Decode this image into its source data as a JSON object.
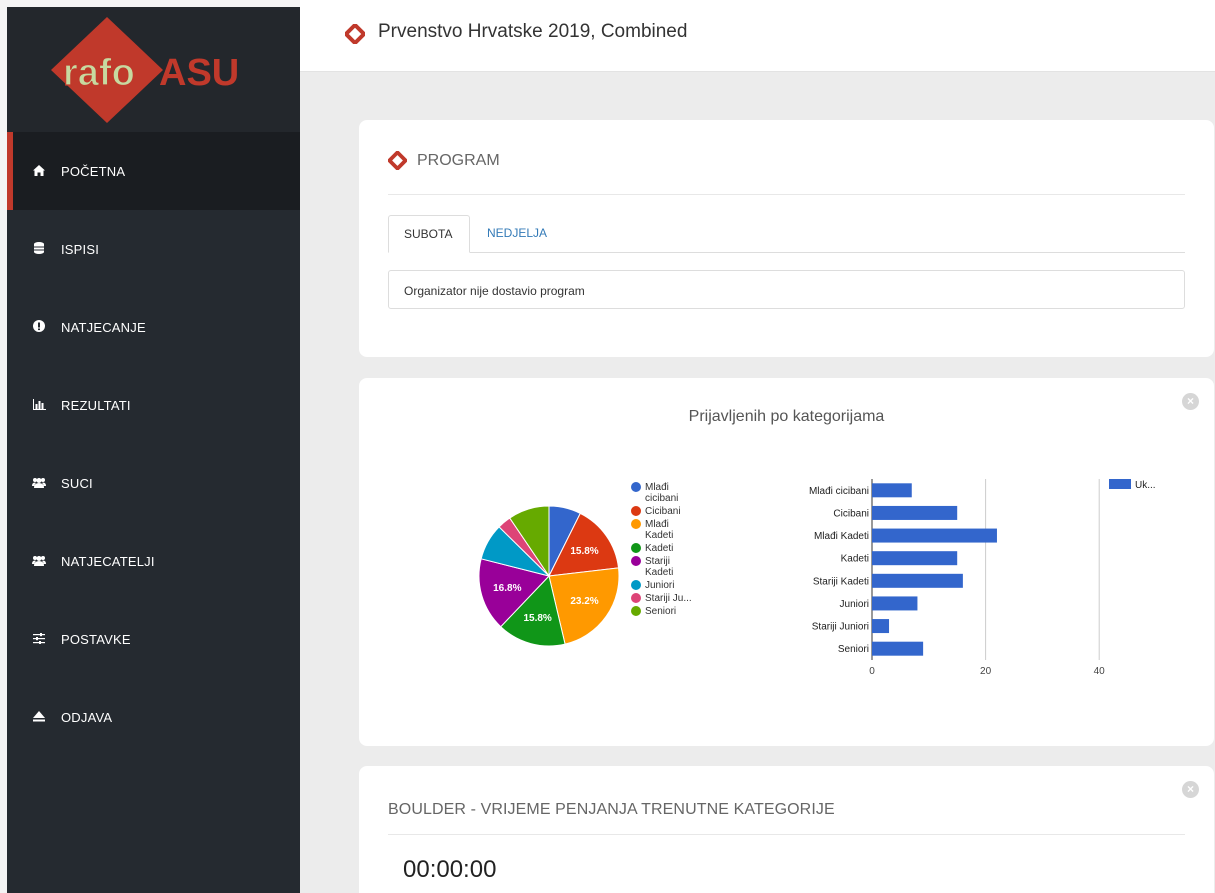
{
  "logo": {
    "text_part1": "rafo",
    "text_part2": "ASU"
  },
  "sidebar": {
    "items": [
      {
        "label": "POČETNA",
        "icon": "home-icon",
        "active": true
      },
      {
        "label": "ISPISI",
        "icon": "database-icon",
        "active": false
      },
      {
        "label": "NATJECANJE",
        "icon": "exclamation-icon",
        "active": false
      },
      {
        "label": "REZULTATI",
        "icon": "bar-chart-icon",
        "active": false
      },
      {
        "label": "SUCI",
        "icon": "users-icon",
        "active": false
      },
      {
        "label": "NATJECATELJI",
        "icon": "users-icon",
        "active": false
      },
      {
        "label": "POSTAVKE",
        "icon": "sliders-icon",
        "active": false
      },
      {
        "label": "ODJAVA",
        "icon": "eject-icon",
        "active": false
      }
    ]
  },
  "header": {
    "title": "Prvenstvo Hrvatske 2019, Combined"
  },
  "program": {
    "heading": "PROGRAM",
    "tabs": [
      {
        "label": "SUBOTA"
      },
      {
        "label": "NEDJELJA"
      }
    ],
    "note": "Organizator nije dostavio program"
  },
  "chart_panel": {
    "title": "Prijavljenih po kategorijama"
  },
  "chart_data": [
    {
      "type": "pie",
      "categories": [
        "Mlađi cicibani",
        "Cicibani",
        "Mlađi Kadeti",
        "Kadeti",
        "Stariji Kadeti",
        "Juniori",
        "Stariji Juniori",
        "Seniori"
      ],
      "legend_labels": [
        "Mlađi cicibani",
        "Cicibani",
        "Mlađi Kadeti",
        "Kadeti",
        "Stariji Kadeti",
        "Juniori",
        "Stariji Ju...",
        "Seniori"
      ],
      "values": [
        7,
        15,
        22,
        15,
        16,
        8,
        3,
        9
      ],
      "slice_labels": [
        "",
        "15.8%",
        "23.2%",
        "15.8%",
        "16.8%",
        "",
        "",
        ""
      ],
      "colors": [
        "#3366cc",
        "#dc3912",
        "#ff9900",
        "#109618",
        "#990099",
        "#0099c6",
        "#dd4477",
        "#66aa00"
      ],
      "legend_position": "right"
    },
    {
      "type": "bar",
      "orientation": "horizontal",
      "categories": [
        "Mlađi cicibani",
        "Cicibani",
        "Mlađi Kadeti",
        "Kadeti",
        "Stariji Kadeti",
        "Juniori",
        "Stariji Juniori",
        "Seniori"
      ],
      "series": [
        {
          "name": "Uk...",
          "values": [
            7,
            15,
            22,
            15,
            16,
            8,
            3,
            9
          ],
          "color": "#3366cc"
        }
      ],
      "xlim": [
        0,
        50
      ],
      "xticks": [
        0,
        20,
        40
      ],
      "grid": true,
      "legend_position": "top-right"
    }
  ],
  "boulder": {
    "heading": "BOULDER - VRIJEME PENJANJA TRENUTNE KATEGORIJE",
    "timer": "00:00:00"
  },
  "colors": {
    "accent": "#c0392b",
    "sidebar_bg": "#252a30",
    "link": "#337ab7"
  }
}
